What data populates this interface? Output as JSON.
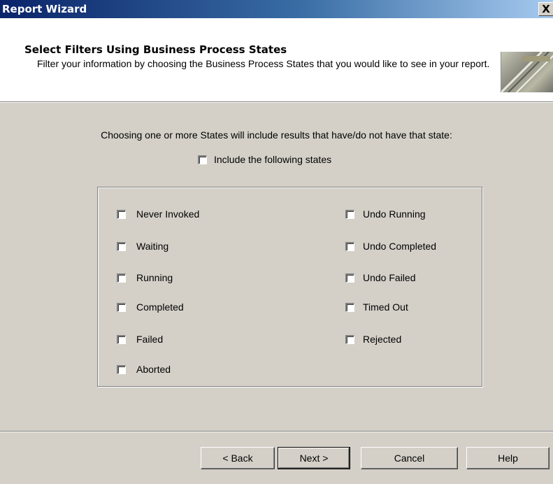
{
  "window": {
    "title": "Report Wizard",
    "close_glyph": "X"
  },
  "header": {
    "title": "Select Filters Using Business Process States",
    "description": "Filter your information by choosing the Business Process States that you would like to see in your report."
  },
  "intro_text": "Choosing one or more States will include results that have/do not have that state:",
  "include_states": {
    "label": "Include the following states",
    "checked": false
  },
  "states": {
    "left": [
      "Never Invoked",
      "Waiting",
      "Running",
      "Completed",
      "Failed",
      "Aborted"
    ],
    "right": [
      "Undo Running",
      "Undo Completed",
      "Undo Failed",
      "Timed Out",
      "Rejected"
    ]
  },
  "buttons": {
    "back": "< Back",
    "next": "Next >",
    "cancel": "Cancel",
    "help": "Help"
  }
}
